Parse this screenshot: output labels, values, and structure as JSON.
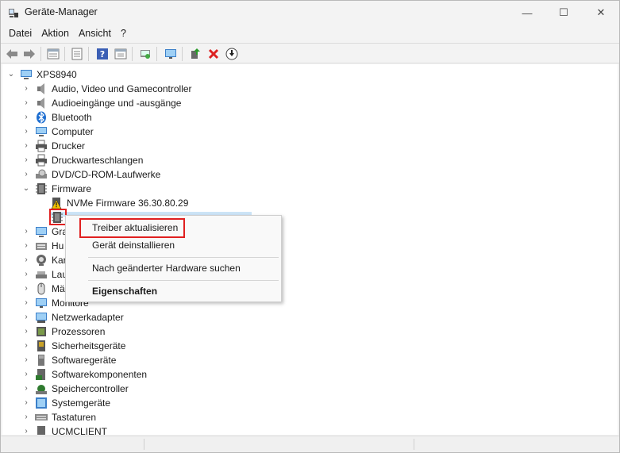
{
  "window": {
    "title": "Geräte-Manager",
    "controls": {
      "minimize": "—",
      "maximize": "☐",
      "close": "✕"
    }
  },
  "menu": [
    "Datei",
    "Aktion",
    "Ansicht",
    "?"
  ],
  "toolbar": {
    "buttons": [
      "back-arrow-icon",
      "forward-arrow-icon",
      "properties-grid-icon",
      "document-icon",
      "help-icon",
      "show-hidden-icon",
      "scan-hardware-icon",
      "monitor-icon",
      "update-driver-icon",
      "uninstall-icon",
      "download-icon"
    ]
  },
  "tree": {
    "root": "XPS8940",
    "categories": [
      {
        "label": "Audio, Video und Gamecontroller",
        "icon": "speaker-icon"
      },
      {
        "label": "Audioeingänge und -ausgänge",
        "icon": "speaker-icon"
      },
      {
        "label": "Bluetooth",
        "icon": "bluetooth-icon"
      },
      {
        "label": "Computer",
        "icon": "computer-icon"
      },
      {
        "label": "Drucker",
        "icon": "printer-icon"
      },
      {
        "label": "Druckwarteschlangen",
        "icon": "printer-queue-icon"
      },
      {
        "label": "DVD/CD-ROM-Laufwerke",
        "icon": "dvd-drive-icon"
      },
      {
        "label": "Firmware",
        "icon": "firmware-icon"
      }
    ],
    "firmware_children": [
      {
        "label": "NVMe Firmware 36.30.80.29",
        "icon": "firmware-warning-icon"
      },
      {
        "label": "",
        "icon": "firmware-chip-icon"
      }
    ],
    "after_categories": [
      {
        "label": "Gra",
        "icon": "display-adapter-icon"
      },
      {
        "label": "Hu",
        "icon": "hid-icon"
      },
      {
        "label": "Kar",
        "icon": "camera-icon"
      },
      {
        "label": "Lau",
        "icon": "disk-drive-icon"
      },
      {
        "label": "Mä",
        "icon": "mouse-icon"
      },
      {
        "label": "Monitore",
        "icon": "monitor-icon"
      },
      {
        "label": "Netzwerkadapter",
        "icon": "network-adapter-icon"
      },
      {
        "label": "Prozessoren",
        "icon": "processor-icon"
      },
      {
        "label": "Sicherheitsgeräte",
        "icon": "security-device-icon"
      },
      {
        "label": "Softwaregeräte",
        "icon": "software-device-icon"
      },
      {
        "label": "Softwarekomponenten",
        "icon": "software-component-icon"
      },
      {
        "label": "Speichercontroller",
        "icon": "storage-controller-icon"
      },
      {
        "label": "Systemgeräte",
        "icon": "system-device-icon"
      },
      {
        "label": "Tastaturen",
        "icon": "keyboard-icon"
      },
      {
        "label": "UCMCLIENT",
        "icon": "ucm-client-icon"
      }
    ]
  },
  "context_menu": {
    "items": [
      "Treiber aktualisieren",
      "Gerät deinstallieren",
      "Nach geänderter Hardware suchen",
      "Eigenschaften"
    ]
  },
  "colors": {
    "highlight_red": "#e02020",
    "selection_blue": "#cce4f7"
  }
}
